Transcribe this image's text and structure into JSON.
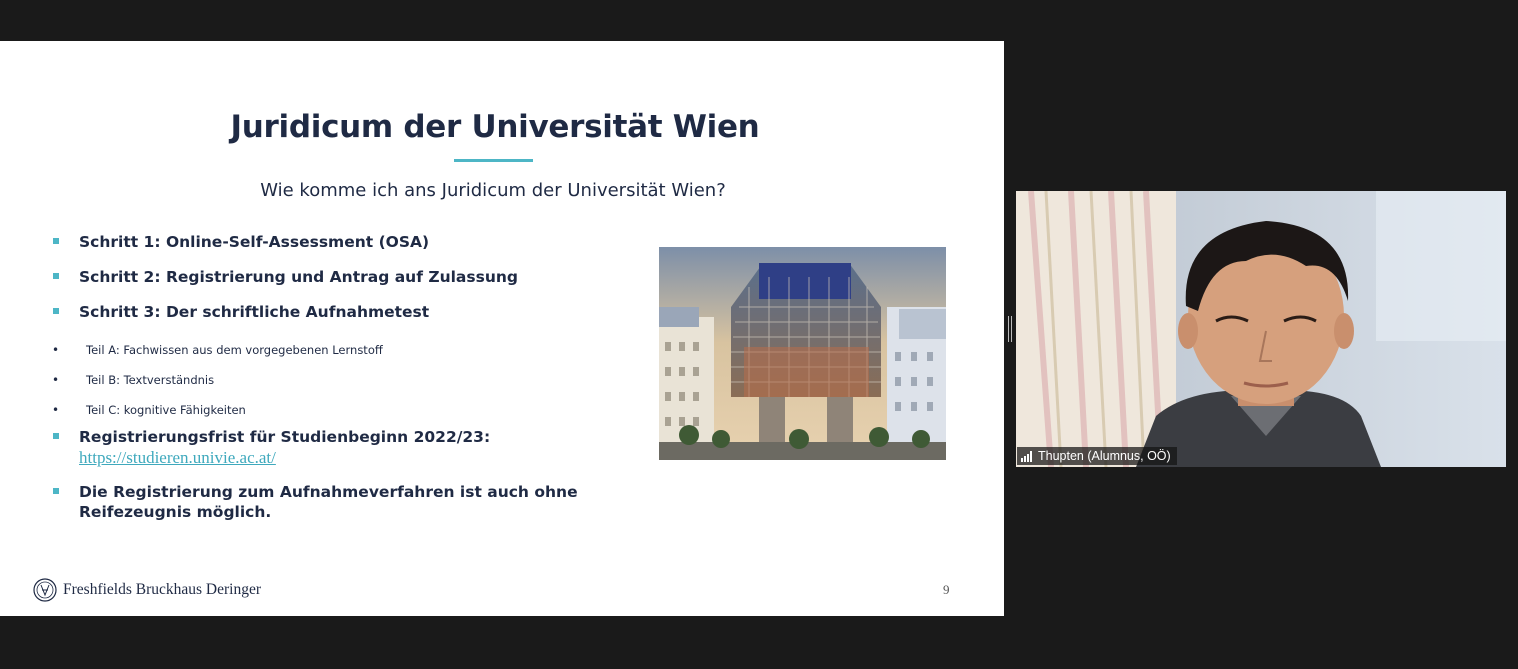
{
  "slide": {
    "title": "Juridicum der Universität Wien",
    "subtitle": "Wie komme ich ans Juridicum der Universität Wien?",
    "steps": [
      "Schritt 1: Online-Self-Assessment (OSA)",
      "Schritt 2: Registrierung und Antrag auf Zulassung",
      "Schritt 3: Der schriftliche Aufnahmetest"
    ],
    "sub_items": [
      "Teil A: Fachwissen aus dem vorgegebenen Lernstoff",
      "Teil B: Textverständnis",
      "Teil C: kognitive Fähigkeiten"
    ],
    "deadline_label": "Registrierungsfrist für Studienbeginn 2022/23:",
    "deadline_link": "https://studieren.univie.ac.at/",
    "note_line1": "Die Registrierung zum Aufnahmeverfahren ist auch ohne",
    "note_line2": "Reifezeugnis möglich.",
    "footer_logo": "Freshfields Bruckhaus Deringer",
    "page_number": "9",
    "accent_color": "#4db6c6",
    "text_color": "#1f2a44"
  },
  "participant": {
    "name": "Thupten (Alumnus, OÖ)",
    "signal_icon": "signal-bars-icon"
  }
}
